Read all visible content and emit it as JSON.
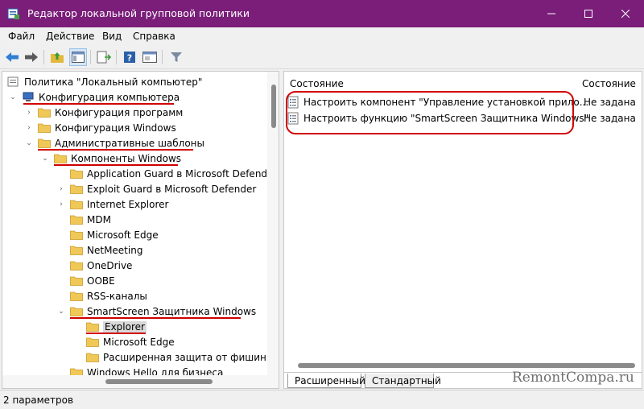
{
  "window": {
    "title": "Редактор локальной групповой политики",
    "icon": "gpedit-icon",
    "accent_color": "#7a1e7a",
    "controls": {
      "minimize": "minimize-icon",
      "maximize": "maximize-icon",
      "close": "close-icon"
    }
  },
  "menu": {
    "items": [
      "Файл",
      "Действие",
      "Вид",
      "Справка"
    ]
  },
  "toolbar": {
    "icons": [
      "back-arrow-icon",
      "forward-arrow-icon",
      "up-folder-icon",
      "show-tree-icon",
      "export-list-icon",
      "help-icon",
      "properties-icon",
      "filter-icon"
    ]
  },
  "tree": {
    "items": [
      {
        "label": "Политика \"Локальный компьютер\"",
        "icon": "computer-policy-icon",
        "expanded": true
      },
      {
        "label": "Конфигурация компьютера",
        "icon": "computer-icon",
        "expanded": true
      },
      {
        "label": "Конфигурация программ",
        "icon": "folder-icon",
        "expanded": false
      },
      {
        "label": "Конфигурация Windows",
        "icon": "folder-icon",
        "expanded": false
      },
      {
        "label": "Административные шаблоны",
        "icon": "folder-icon",
        "expanded": true
      },
      {
        "label": "Компоненты Windows",
        "icon": "folder-icon",
        "expanded": true
      },
      {
        "label": "Application Guard в Microsoft Defender",
        "icon": "folder-icon"
      },
      {
        "label": "Exploit Guard в Microsoft Defender",
        "icon": "folder-icon",
        "expanded": false
      },
      {
        "label": "Internet Explorer",
        "icon": "folder-icon",
        "expanded": false
      },
      {
        "label": "MDM",
        "icon": "folder-icon"
      },
      {
        "label": "Microsoft Edge",
        "icon": "folder-icon"
      },
      {
        "label": "NetMeeting",
        "icon": "folder-icon"
      },
      {
        "label": "OneDrive",
        "icon": "folder-icon"
      },
      {
        "label": "OOBE",
        "icon": "folder-icon"
      },
      {
        "label": "RSS-каналы",
        "icon": "folder-icon"
      },
      {
        "label": "SmartScreen Защитника Windows",
        "icon": "folder-icon",
        "expanded": true
      },
      {
        "label": "Explorer",
        "icon": "folder-icon",
        "selected": true
      },
      {
        "label": "Microsoft Edge",
        "icon": "folder-icon"
      },
      {
        "label": "Расширенная защита от фишинга",
        "icon": "folder-icon"
      },
      {
        "label": "Windows Hello для бизнеса",
        "icon": "folder-icon"
      }
    ]
  },
  "list": {
    "columns": [
      "Состояние",
      "Состояние"
    ],
    "rows": [
      {
        "name": "Настроить компонент \"Управление установкой прило...",
        "state": "Не задана",
        "icon": "policy-setting-icon"
      },
      {
        "name": "Настроить функцию \"SmartScreen Защитника Windows\"",
        "state": "Не задана",
        "icon": "policy-setting-icon"
      }
    ]
  },
  "tabs": [
    "Расширенный",
    "Стандартный"
  ],
  "status": {
    "text": "2 параметров"
  },
  "watermark": "RemontCompa.ru",
  "annotation_color": "#d10000"
}
